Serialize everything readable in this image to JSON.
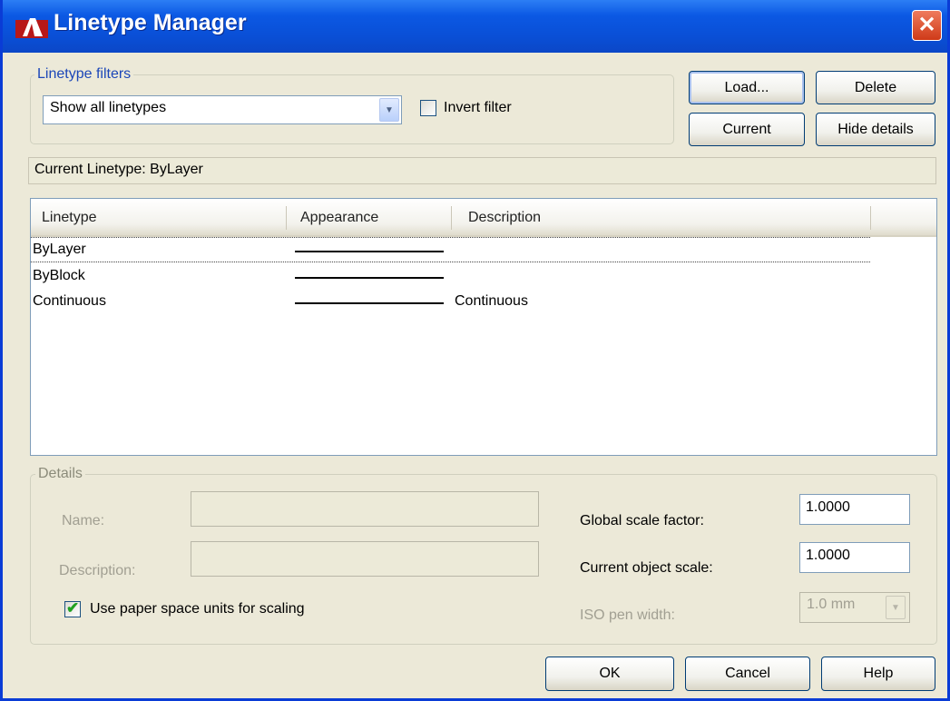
{
  "window": {
    "title": "Linetype Manager",
    "close_symbol": "✕"
  },
  "filters": {
    "group_label": "Linetype filters",
    "selected": "Show all linetypes",
    "invert_label": "Invert filter",
    "invert_checked": false
  },
  "buttons": {
    "load": "Load...",
    "delete": "Delete",
    "current": "Current",
    "hide_details": "Hide details"
  },
  "current_linetype": "Current Linetype:  ByLayer",
  "list": {
    "columns": [
      "Linetype",
      "Appearance",
      "Description"
    ],
    "rows": [
      {
        "name": "ByLayer",
        "description": ""
      },
      {
        "name": "ByBlock",
        "description": ""
      },
      {
        "name": "Continuous",
        "description": "Continuous"
      }
    ]
  },
  "details": {
    "group_label": "Details",
    "name_label": "Name:",
    "name_value": "",
    "description_label": "Description:",
    "description_value": "",
    "paper_space_label": "Use paper space units for scaling",
    "paper_space_checked": true,
    "global_scale_label": "Global scale factor:",
    "global_scale_value": "1.0000",
    "object_scale_label": "Current object scale:",
    "object_scale_value": "1.0000",
    "iso_label": "ISO pen width:",
    "iso_value": "1.0 mm"
  },
  "footer": {
    "ok": "OK",
    "cancel": "Cancel",
    "help": "Help"
  },
  "colors": {
    "titlebar": "#0a4fd6",
    "group_title": "#1b46b8",
    "face": "#ece9d8"
  }
}
